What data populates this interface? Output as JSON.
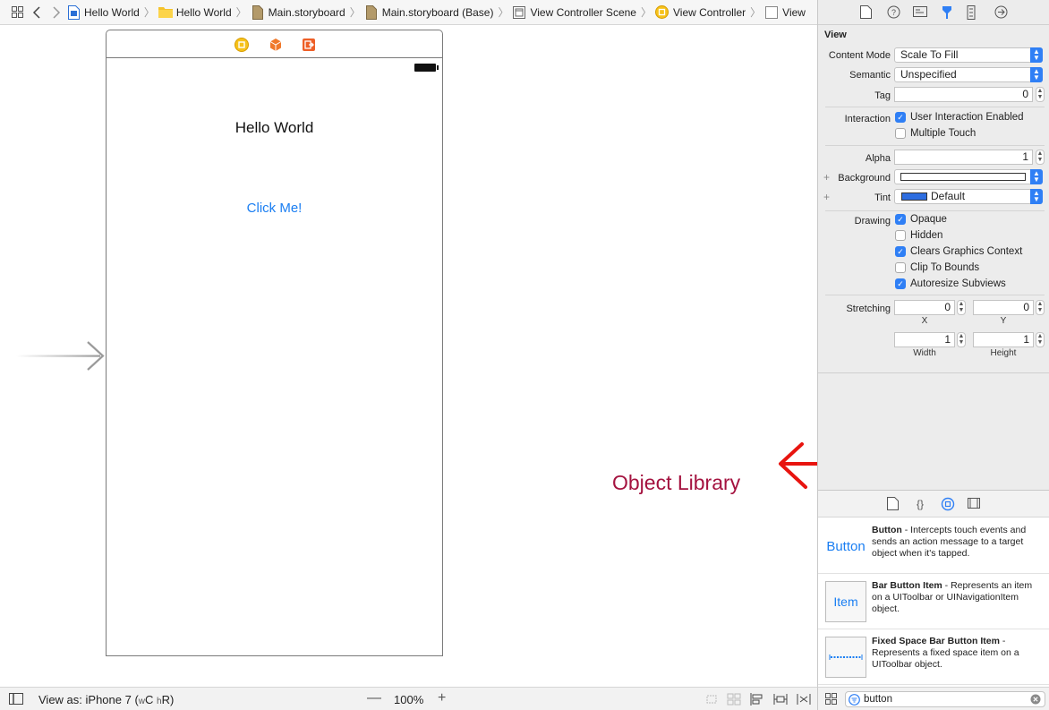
{
  "breadcrumb": [
    {
      "label": "Hello World",
      "icon": "project-file-icon"
    },
    {
      "label": "Hello World",
      "icon": "folder-icon"
    },
    {
      "label": "Main.storyboard",
      "icon": "storyboard-file-icon"
    },
    {
      "label": "Main.storyboard (Base)",
      "icon": "storyboard-file-icon"
    },
    {
      "label": "View Controller Scene",
      "icon": "scene-icon"
    },
    {
      "label": "View Controller",
      "icon": "view-controller-icon"
    },
    {
      "label": "View",
      "icon": "view-icon"
    }
  ],
  "canvas": {
    "label_text": "Hello World",
    "button_text": "Click Me!",
    "annotation": "Object Library",
    "colors": {
      "button": "#1a7ef2",
      "annotation": "#a4123f",
      "marker": "#e8140f"
    }
  },
  "bottom_bar": {
    "view_as": "View as: iPhone 7",
    "size_class_w": "w",
    "size_class_c": "C",
    "size_class_h": "h",
    "size_class_r": "R",
    "zoom": "100%",
    "zoom_out": "—",
    "zoom_in": "+"
  },
  "inspector": {
    "section": "View",
    "content_mode": {
      "label": "Content Mode",
      "value": "Scale To Fill"
    },
    "semantic": {
      "label": "Semantic",
      "value": "Unspecified"
    },
    "tag": {
      "label": "Tag",
      "value": "0"
    },
    "interaction": {
      "label": "Interaction",
      "options": [
        {
          "label": "User Interaction Enabled",
          "checked": true
        },
        {
          "label": "Multiple Touch",
          "checked": false
        }
      ]
    },
    "alpha": {
      "label": "Alpha",
      "value": "1"
    },
    "background": {
      "label": "Background"
    },
    "tint": {
      "label": "Tint",
      "value": "Default",
      "swatch": "#2d6de0"
    },
    "drawing": {
      "label": "Drawing",
      "options": [
        {
          "label": "Opaque",
          "checked": true
        },
        {
          "label": "Hidden",
          "checked": false
        },
        {
          "label": "Clears Graphics Context",
          "checked": true
        },
        {
          "label": "Clip To Bounds",
          "checked": false
        },
        {
          "label": "Autoresize Subviews",
          "checked": true
        }
      ]
    },
    "stretching": {
      "label": "Stretching",
      "x": "0",
      "y": "0",
      "width": "1",
      "height": "1",
      "x_label": "X",
      "y_label": "Y",
      "width_label": "Width",
      "height_label": "Height"
    }
  },
  "library": {
    "items": [
      {
        "thumb": "Button",
        "name": "Button",
        "description": " - Intercepts touch events and sends an action message to a target object when it's tapped."
      },
      {
        "thumb": "Item",
        "name": "Bar Button Item",
        "description": " - Represents an item on a UIToolbar or UINavigationItem object."
      },
      {
        "thumb": "",
        "name": "Fixed Space Bar Button Item",
        "description": " - Represents a fixed space item on a UIToolbar object."
      }
    ],
    "filter": "button"
  }
}
